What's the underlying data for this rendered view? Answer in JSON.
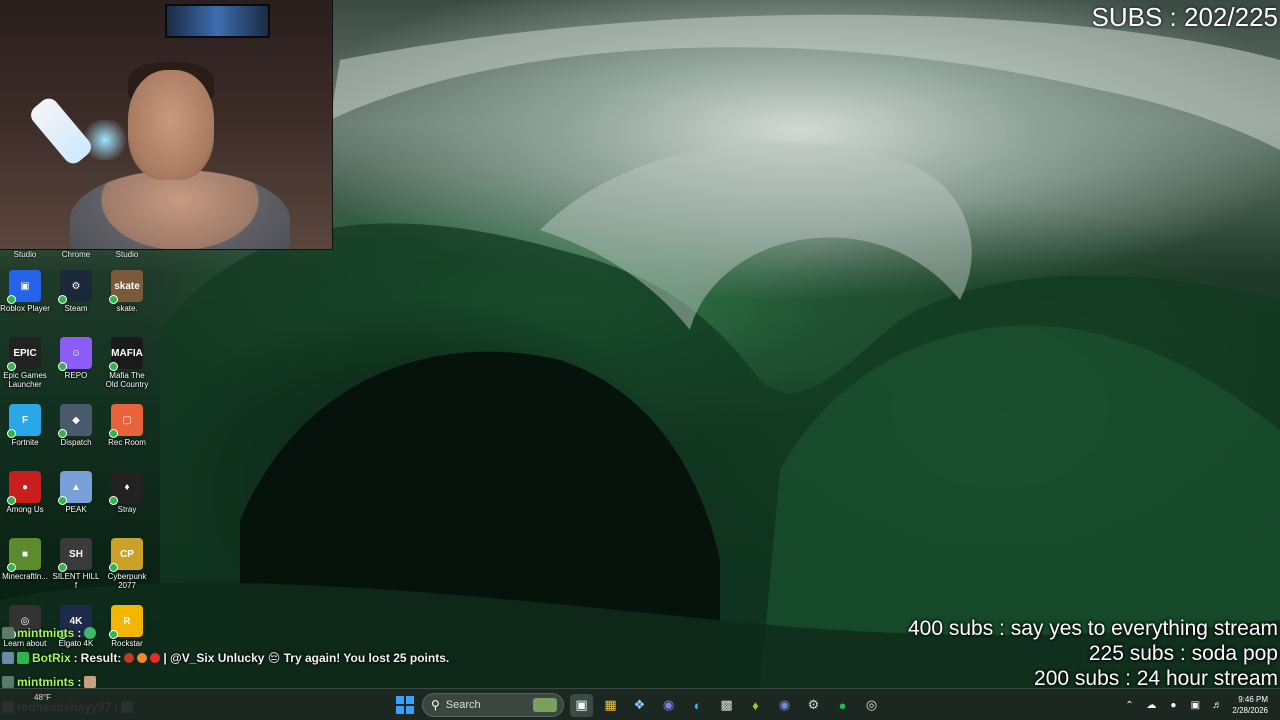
{
  "overlay": {
    "subs_counter": "SUBS : 202/225",
    "goals": [
      "400 subs :  say yes to everything stream",
      "225 subs : soda pop",
      "200 subs : 24 hour stream"
    ]
  },
  "desktop": {
    "partial_labels": [
      "Studio",
      "Chrome",
      "Studio"
    ],
    "icons": [
      {
        "label": "Roblox Player",
        "color": "#2563eb",
        "glyph": "▣"
      },
      {
        "label": "Steam",
        "color": "#1b2838",
        "glyph": "⚙"
      },
      {
        "label": "skate.",
        "color": "#7a5a3a",
        "glyph": "skate"
      },
      {
        "label": "Epic Games Launcher",
        "color": "#222222",
        "glyph": "EPIC"
      },
      {
        "label": "REPO",
        "color": "#8b5cf6",
        "glyph": "☺"
      },
      {
        "label": "Mafia The Old Country",
        "color": "#1a1a1a",
        "glyph": "MAFIA"
      },
      {
        "label": "Fortnite",
        "color": "#2aa7e8",
        "glyph": "F"
      },
      {
        "label": "Dispatch",
        "color": "#4a5a6a",
        "glyph": "◆"
      },
      {
        "label": "Rec Room",
        "color": "#e8623a",
        "glyph": "▢"
      },
      {
        "label": "Among Us",
        "color": "#c81e1e",
        "glyph": "●"
      },
      {
        "label": "PEAK",
        "color": "#7aa0d8",
        "glyph": "▲"
      },
      {
        "label": "Stray",
        "color": "#222222",
        "glyph": "♦"
      },
      {
        "label": "Minecraftln...",
        "color": "#5d8a2c",
        "glyph": "■"
      },
      {
        "label": "SILENT HILL f",
        "color": "#3a3a3a",
        "glyph": "SH"
      },
      {
        "label": "Cyberpunk 2077",
        "color": "#c9a227",
        "glyph": "CP"
      },
      {
        "label": "Learn about",
        "color": "#333333",
        "glyph": "◎"
      },
      {
        "label": "Elgato 4K",
        "color": "#1e2a4a",
        "glyph": "4K"
      },
      {
        "label": "Rockstar",
        "color": "#f2b600",
        "glyph": "R"
      }
    ]
  },
  "chat": [
    {
      "user": "mintmints",
      "sep": ":",
      "message": "",
      "user_color": "green"
    },
    {
      "user": "BotRix",
      "sep": ":",
      "message": "Result: ",
      "after_dots": "| @V_Six Unlucky 😔 Try again! You lost 25 points.",
      "user_color": "green"
    },
    {
      "user": "mintmints",
      "sep": ":",
      "message": "",
      "user_color": "green"
    },
    {
      "user": "redheadshayy97",
      "sep": ":",
      "message": "",
      "user_color": "pink"
    }
  ],
  "taskbar": {
    "weather": "48°F",
    "search_placeholder": "Search",
    "time": "9:46 PM",
    "date": "2/28/2026"
  },
  "colors": {
    "accent": "#2fb54a",
    "chat_green": "#9cff54",
    "chat_pink": "#e7a8ff"
  }
}
